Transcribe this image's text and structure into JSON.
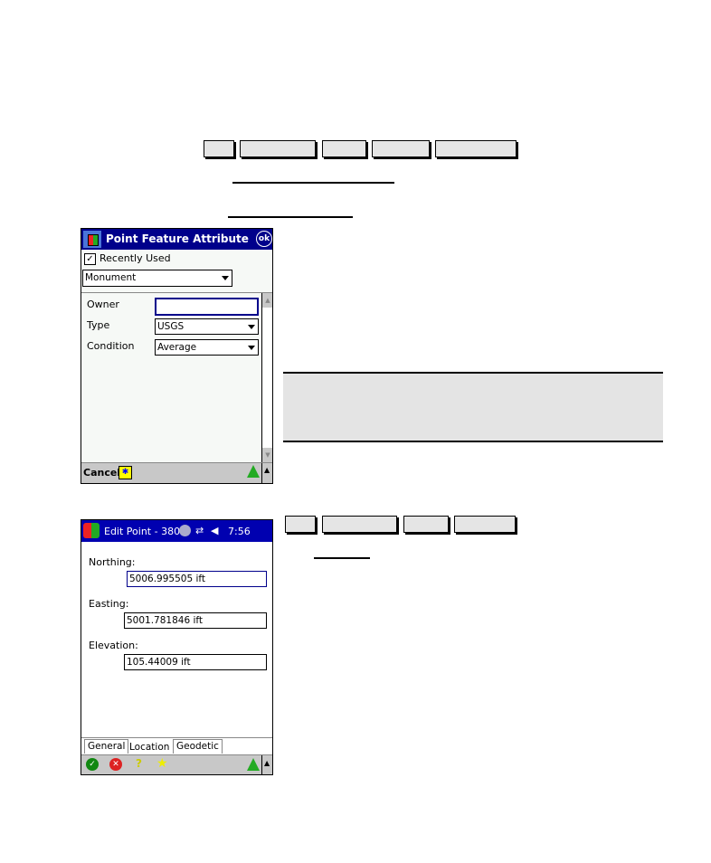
{
  "top_nav": {
    "buttons": [
      "",
      "",
      "",
      "",
      ""
    ]
  },
  "top_links": [
    "",
    ""
  ],
  "device1": {
    "title": "Point Feature Attribute",
    "ok_label": "ok",
    "recently_used_label": "Recently Used",
    "recently_used_checked": true,
    "feature_select": "Monument",
    "fields": [
      {
        "label": "Owner",
        "value": "",
        "type": "text"
      },
      {
        "label": "Type",
        "value": "USGS",
        "type": "select"
      },
      {
        "label": "Condition",
        "value": "Average",
        "type": "select"
      }
    ],
    "cancel_label": "Cancel",
    "colors": {
      "title_bg": "#00008b",
      "focus_border": "#00008b"
    }
  },
  "note_box": {
    "text": ""
  },
  "mid_nav": {
    "buttons": [
      "",
      "",
      "",
      ""
    ]
  },
  "mid_link": "",
  "device2": {
    "title": "Edit Point - 380",
    "time": "7:56",
    "fields": [
      {
        "label": "Northing:",
        "value": "5006.995505 ift"
      },
      {
        "label": "Easting:",
        "value": "5001.781846 ift"
      },
      {
        "label": "Elevation:",
        "value": "105.44009 ift"
      }
    ],
    "tabs": [
      "General",
      "Location",
      "Geodetic"
    ],
    "active_tab": "Location",
    "toolbar_icons": [
      "ok-icon",
      "cancel-icon",
      "help-icon",
      "favorite-icon"
    ]
  }
}
